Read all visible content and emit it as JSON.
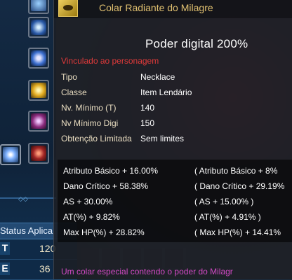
{
  "sidebar": {
    "slots": [
      {
        "icon": "gem-icon"
      },
      {
        "icon": "crystal-icon"
      },
      {
        "icon": "orb-icon"
      },
      {
        "icon": "golden-eye-icon"
      },
      {
        "icon": "purple-rune-icon"
      },
      {
        "icon": "red-book-icon"
      }
    ],
    "left_slot_icon": "star-burst-icon",
    "status_label": "Status Aplica",
    "stats": [
      {
        "key": "T",
        "value": "120"
      },
      {
        "key": "E",
        "value": "36"
      }
    ]
  },
  "tooltip": {
    "title": "Colar Radiante do Milagre",
    "power": "Poder digital 200%",
    "bound": "Vinculado ao personagem",
    "info": [
      {
        "label": "Tipo",
        "value": "Necklace"
      },
      {
        "label": "Classe",
        "value": "Item Lendário"
      },
      {
        "label": "Nv. Mínimo (T)",
        "value": "140"
      },
      {
        "label": "Nv Mínimo Digi",
        "value": "150"
      },
      {
        "label": "Obtenção Limitada",
        "value": "Sem limites"
      }
    ],
    "stats": [
      {
        "base": "Atributo Básico + 16.00%",
        "digital": "( Atributo Básico + 8%"
      },
      {
        "base": "Dano Crítico + 58.38%",
        "digital": "( Dano Crítico + 29.19%"
      },
      {
        "base": "AS + 30.00%",
        "digital": "( AS + 15.00% )"
      },
      {
        "base": "AT(%) + 9.82%",
        "digital": "( AT(%) + 4.91% )"
      },
      {
        "base": "Max HP(%) + 28.82%",
        "digital": "( Max HP(%) + 14.41%"
      }
    ],
    "description": "Um colar especial contendo o poder do Milagr"
  },
  "colors": {
    "title": "#e0c070",
    "bound": "#e03a3a",
    "description": "#d24ac4",
    "label": "#e8dcc0"
  }
}
